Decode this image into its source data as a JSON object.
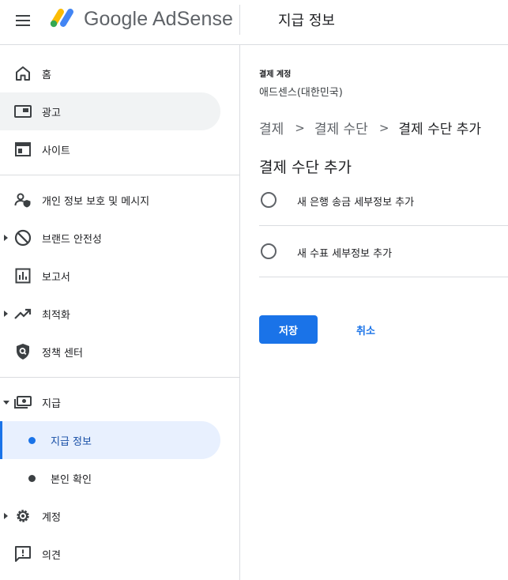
{
  "header": {
    "brand": "Google AdSense",
    "page_title": "지급 정보"
  },
  "sidebar": {
    "items": [
      {
        "label": "홈",
        "icon": "home-icon"
      },
      {
        "label": "광고",
        "icon": "ads-icon"
      },
      {
        "label": "사이트",
        "icon": "sites-icon"
      },
      {
        "label": "개인 정보 보호 및 메시지",
        "icon": "privacy-messaging-icon"
      },
      {
        "label": "브랜드 안전성",
        "icon": "block-icon"
      },
      {
        "label": "보고서",
        "icon": "reports-icon"
      },
      {
        "label": "최적화",
        "icon": "trending-up-icon"
      },
      {
        "label": "정책 센터",
        "icon": "policy-shield-icon"
      },
      {
        "label": "지급",
        "icon": "payments-icon"
      },
      {
        "label": "지급 정보"
      },
      {
        "label": "본인 확인"
      },
      {
        "label": "계정",
        "icon": "gear-icon"
      },
      {
        "label": "의견",
        "icon": "feedback-icon"
      }
    ]
  },
  "main": {
    "account_label": "결제 계정",
    "account_value": "애드센스(대한민국)",
    "breadcrumb": [
      "결제",
      "결제 수단",
      "결제 수단 추가"
    ],
    "section_title": "결제 수단 추가",
    "options": [
      {
        "label": "새 은행 송금 세부정보 추가",
        "selected": false
      },
      {
        "label": "새 수표 세부정보 추가",
        "selected": false
      }
    ],
    "save_label": "저장",
    "cancel_label": "취소"
  },
  "colors": {
    "accent": "#1a73e8",
    "selected_bg": "#e8f0fe",
    "hover_bg": "#f1f3f4"
  }
}
